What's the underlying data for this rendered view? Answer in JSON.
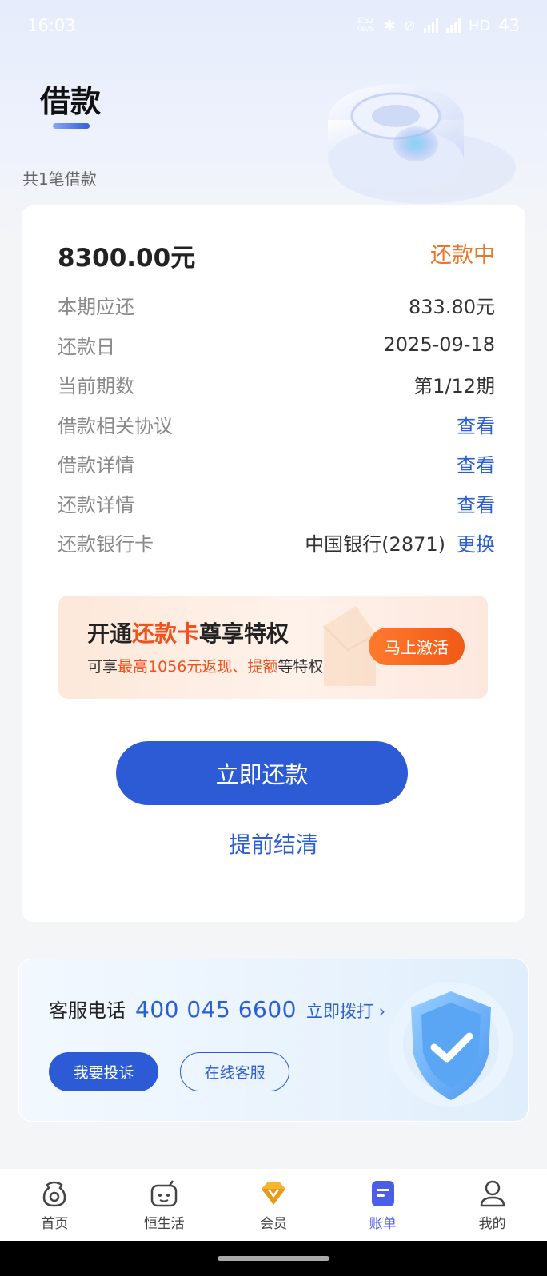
{
  "status_bar": {
    "time": "16:03",
    "net_speed": "4.52 KB/S",
    "signal1": "5G",
    "signal2": "5G",
    "hd": "HD",
    "battery": "43"
  },
  "header": {
    "title": "借款",
    "count_text": "共1笔借款"
  },
  "loan": {
    "amount": "8300.00元",
    "status": "还款中",
    "rows": [
      {
        "label": "本期应还",
        "value": "833.80元"
      },
      {
        "label": "还款日",
        "value": "2025-09-18"
      },
      {
        "label": "当前期数",
        "value": "第1/12期"
      },
      {
        "label": "借款相关协议",
        "link": "查看"
      },
      {
        "label": "借款详情",
        "link": "查看"
      },
      {
        "label": "还款详情",
        "link": "查看"
      },
      {
        "label": "还款银行卡",
        "value": "中国银行(2871)",
        "link": "更换"
      }
    ]
  },
  "promo": {
    "title_pre": "开通",
    "title_hl": "还款卡",
    "title_post": "尊享特权",
    "sub_pre": "可享",
    "sub_hl1": "最高1056元返现、提额",
    "sub_post": "等特权",
    "button": "马上激活"
  },
  "actions": {
    "pay_now": "立即还款",
    "prepay": "提前结清"
  },
  "service": {
    "label": "客服电话",
    "phone": "400 045 6600",
    "call": "立即拨打",
    "complain": "我要投诉",
    "online": "在线客服"
  },
  "tabbar": [
    {
      "label": "首页",
      "icon": "home-icon"
    },
    {
      "label": "恒生活",
      "icon": "life-icon"
    },
    {
      "label": "会员",
      "icon": "diamond-icon"
    },
    {
      "label": "账单",
      "icon": "bill-icon",
      "active": true
    },
    {
      "label": "我的",
      "icon": "profile-icon"
    }
  ],
  "colors": {
    "primary": "#2c5bd5",
    "link": "#2b5ed6",
    "status_orange": "#e8772b",
    "promo_orange": "#f2501d"
  }
}
